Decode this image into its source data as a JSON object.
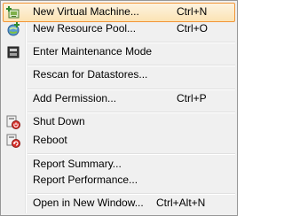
{
  "menu": {
    "items": [
      {
        "label": "New Virtual Machine...",
        "shortcut": "Ctrl+N",
        "icon": "new-vm-icon",
        "highlighted": true
      },
      {
        "label": "New Resource Pool...",
        "shortcut": "Ctrl+O",
        "icon": "resource-pool-icon"
      },
      {
        "label": "Enter Maintenance Mode",
        "shortcut": "",
        "icon": "maintenance-icon"
      },
      {
        "label": "Rescan for Datastores...",
        "shortcut": ""
      },
      {
        "label": "Add Permission...",
        "shortcut": "Ctrl+P"
      },
      {
        "label": "Shut Down",
        "shortcut": "",
        "icon": "shutdown-icon"
      },
      {
        "label": "Reboot",
        "shortcut": "",
        "icon": "reboot-icon"
      },
      {
        "label": "Report Summary...",
        "shortcut": ""
      },
      {
        "label": "Report Performance...",
        "shortcut": ""
      },
      {
        "label": "Open in New Window...",
        "shortcut": "Ctrl+Alt+N"
      }
    ],
    "colors": {
      "highlight_border": "#f29536",
      "highlight_fill": "#fbe3b4",
      "background": "#f0f0f0"
    }
  }
}
